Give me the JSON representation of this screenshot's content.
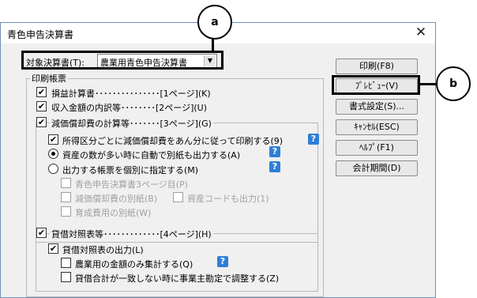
{
  "window": {
    "title": "青色申告決算書",
    "close_glyph": "✕"
  },
  "target": {
    "label": "対象決算書(T):",
    "value": "農業用青色申告決算書"
  },
  "print_group": {
    "title": "印刷帳票"
  },
  "items": {
    "pl": "損益計算書･･･････････････[1ページ](K)",
    "income": "収入金額の内訳等････････[2ページ](U)",
    "depreciation": "減価償却費の計算等･･･････[3ページ](G)",
    "per_category": "所得区分ごとに減価償却費をあん分に従って印刷する(9)",
    "auto_separate": "資産の数が多い時に自動で別紙も出力する(A)",
    "individual": "出力する帳票を個別に指定する(M)",
    "p3": "青色申告決算書3ページ目(P)",
    "separate_sheet": "減価償却費の別紙(B)",
    "asset_code": "資産コードも出力(1)",
    "growing_cost": "育成費用の別紙(W)",
    "balance": "貸借対照表等･････････････[4ページ](H)",
    "balance_output": "貸借対照表の出力(L)",
    "agri_only": "農業用の金額のみ集計する(Q)",
    "mismatch": "貸借合計が一致しない時に事業主勘定で調整する(Z)"
  },
  "checks": {
    "check": "✔"
  },
  "help": {
    "glyph": "?"
  },
  "buttons": {
    "print": "印刷(F8)",
    "preview": "ﾌﾟﾚﾋﾞｭｰ(V)",
    "format": "書式設定(S)...",
    "cancel": "ｷｬﾝｾﾙ(ESC)",
    "help": "ﾍﾙﾌﾟ(F1)",
    "period": "会計期間(D)"
  },
  "callouts": {
    "a": "a",
    "b": "b"
  }
}
